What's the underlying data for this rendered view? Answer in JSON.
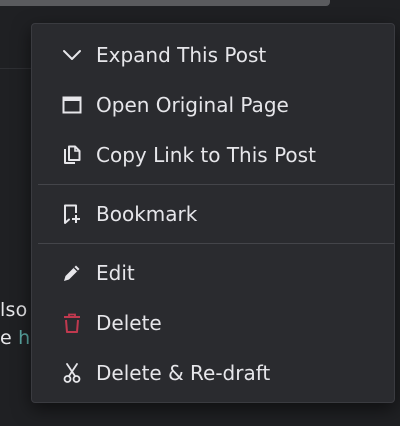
{
  "background": {
    "snippet_line1": "lso",
    "snippet_line2_prefix": "e ",
    "snippet_line2_link": "h"
  },
  "menu": {
    "items": [
      {
        "label": "Expand This Post",
        "icon": "chevron-down-icon"
      },
      {
        "label": "Open Original Page",
        "icon": "window-icon"
      },
      {
        "label": "Copy Link to This Post",
        "icon": "copy-icon"
      },
      {
        "label": "Bookmark",
        "icon": "bookmark-add-icon"
      },
      {
        "label": "Edit",
        "icon": "pencil-icon"
      },
      {
        "label": "Delete",
        "icon": "trash-icon"
      },
      {
        "label": "Delete & Re-draft",
        "icon": "scissors-icon"
      }
    ]
  },
  "colors": {
    "menu_bg": "#2a2b2f",
    "text": "#e6e6ea",
    "delete_icon": "#c0394f",
    "link": "#5aa9a4"
  }
}
